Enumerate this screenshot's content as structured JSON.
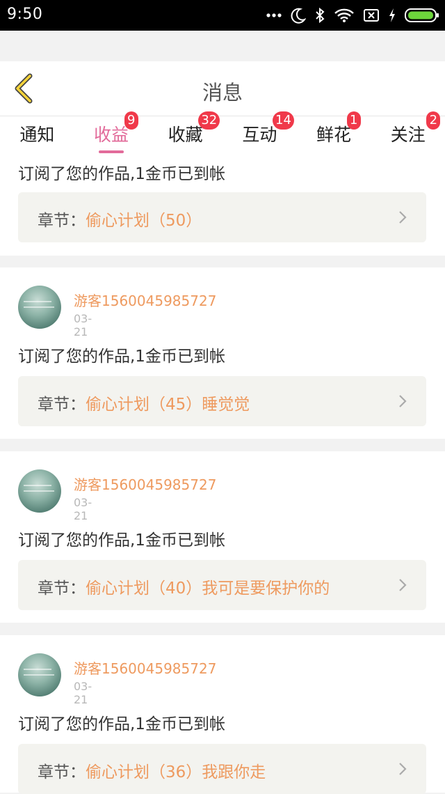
{
  "statusbar": {
    "time": "9:50",
    "icons": [
      "more-dots-icon",
      "moon-icon",
      "bluetooth-icon",
      "wifi-icon",
      "sim-off-icon",
      "charging-icon",
      "battery-icon"
    ]
  },
  "header": {
    "title": "消息"
  },
  "tabs": [
    {
      "label": "通知",
      "badge": ""
    },
    {
      "label": "收益",
      "badge": "9"
    },
    {
      "label": "收藏",
      "badge": "32"
    },
    {
      "label": "互动",
      "badge": "14"
    },
    {
      "label": "鲜花",
      "badge": "1"
    },
    {
      "label": "关注",
      "badge": "2"
    }
  ],
  "active_tab": 1,
  "colors": {
    "accent_pink": "#e26b9a",
    "badge_red": "#f0394a",
    "orange_text": "#ee9a5f",
    "chapter_bg": "#f3f3ef"
  },
  "messages": [
    {
      "user": "",
      "date": "",
      "text": "订阅了您的作品,1金币已到帐",
      "chapter_prefix": "章节：",
      "chapter": "偷心计划（50）"
    },
    {
      "user": "游客1560045985727",
      "date": "03-21",
      "text": "订阅了您的作品,1金币已到帐",
      "chapter_prefix": "章节：",
      "chapter": "偷心计划（45）睡觉觉"
    },
    {
      "user": "游客1560045985727",
      "date": "03-21",
      "text": "订阅了您的作品,1金币已到帐",
      "chapter_prefix": "章节：",
      "chapter": "偷心计划（40）我可是要保护你的"
    },
    {
      "user": "游客1560045985727",
      "date": "03-21",
      "text": "订阅了您的作品,1金币已到帐",
      "chapter_prefix": "章节：",
      "chapter": "偷心计划（36）我跟你走"
    }
  ]
}
